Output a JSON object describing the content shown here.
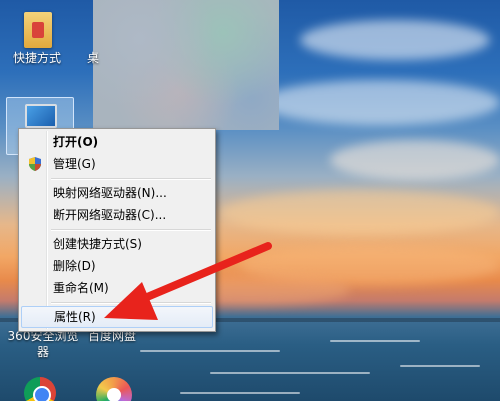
{
  "desktop": {
    "shortcut_label": "快捷方式",
    "partial_label": "桌",
    "bottom_left_label_line1": "360安全浏览",
    "bottom_left_label_line2": "器",
    "bottom_right_label": "百度网盘",
    "icons": [
      "folder-shortcut-icon",
      "computer-icon",
      "chrome-icon",
      "app-icon"
    ]
  },
  "context_menu": {
    "items": [
      {
        "label": "打开(O)",
        "bold": true
      },
      {
        "label": "管理(G)",
        "icon": "shield-icon"
      },
      {
        "separator": true
      },
      {
        "label": "映射网络驱动器(N)..."
      },
      {
        "label": "断开网络驱动器(C)..."
      },
      {
        "separator": true
      },
      {
        "label": "创建快捷方式(S)"
      },
      {
        "label": "删除(D)"
      },
      {
        "label": "重命名(M)"
      },
      {
        "separator": true
      },
      {
        "label": "属性(R)",
        "highlighted": true
      }
    ]
  },
  "colors": {
    "menu_background": "#f0f0f0",
    "menu_hover_border": "#aecff7",
    "arrow": "#e8231c"
  }
}
